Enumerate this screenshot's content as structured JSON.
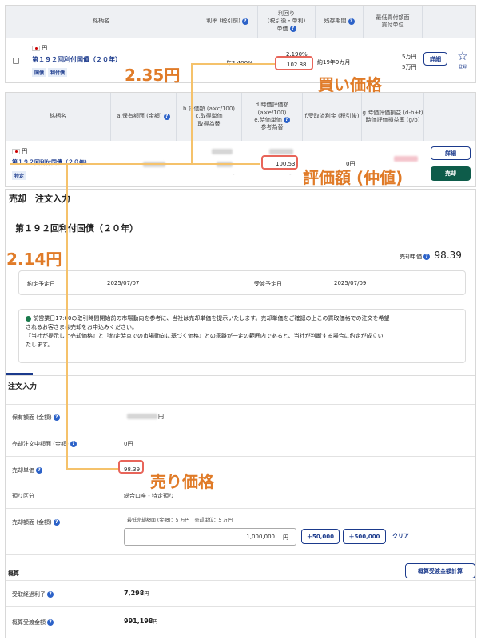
{
  "buy_list": {
    "headers": {
      "name": "銘柄名",
      "rate": "利率 (税引前)",
      "yield1": "利回り",
      "yield2": "(税引後・単利)",
      "price": "単価",
      "term": "残存期間",
      "min1": "最低買付額面",
      "min2": "買付単位"
    },
    "currency": "円",
    "bond_name": "第１９２回利付国債（２０年）",
    "tags": [
      "国債",
      "利付債"
    ],
    "rate": "年2.400%",
    "yield": "2.190%",
    "price": "102.88",
    "term": "約19年9カ月",
    "min_amount": "5万円",
    "unit": "5万円",
    "detail_btn": "詳細",
    "register_label": "登録"
  },
  "holdings": {
    "headers": {
      "name": "銘柄名",
      "face": "a.保有額面 (金額)",
      "eval1": "b.評価額 (a×c/100)",
      "eval2": "c.取得単価",
      "eval3": "取得為替",
      "mark1": "d.時価評価額 (a×e/100)",
      "mark2": "e.時価単価",
      "mark3": "参考為替",
      "recv": "f.受取済利金 (税引後)",
      "pl1": "g.時価評価損益 (d-b+f)",
      "pl2": "時価評価損益率 (g/b)"
    },
    "currency": "円",
    "bond_name": "第１９２回利付国債（２０年）",
    "tag": "特定",
    "mark_price": "100.53",
    "received": "0円",
    "dash1": "-",
    "dash2": "-",
    "detail_btn": "詳細",
    "sell_btn": "売却"
  },
  "sell_order": {
    "header": "売却　注文入力",
    "bond_title": "第１９２回利付国債（２０年）",
    "sell_price_label": "売却単価",
    "sell_price": "98.39",
    "trade_date_label": "約定予定日",
    "trade_date": "2025/07/07",
    "settle_date_label": "受渡予定日",
    "settle_date": "2025/07/09",
    "notice_line1": "前営業日17:00の取引時間開始前の市場動向を参考に、当社は売却単価を提示いたします。売却単価をご確認の上この買取価格での注文を希望",
    "notice_line2": "されるお客さまは売却をお申込みください。",
    "notice_line3": "『当社が提示した売却価格』と『約定時点での市場動向に基づく価格』との乖離が一定の範囲内であると、当社が判断する場合に約定が成立い",
    "notice_line4": "たします。",
    "section_title": "注文入力",
    "rows": {
      "held_label": "保有額面 (金額)",
      "held_suffix": "円",
      "pending_label": "売却注文中額面 (金額)",
      "pending_value": "0円",
      "price_label": "売却単価",
      "price_value": "98.39",
      "custody_label": "預り区分",
      "custody_value": "総合口座・特定預り",
      "amount_label": "売却額面 (金額)",
      "amount_note": "最低売却額面 (金額)：5 万円　売却単位：5 万円",
      "amount_value": "1,000,000",
      "amount_unit": "円",
      "plus50": "＋50,000",
      "plus500": "＋500,000",
      "clear": "クリア"
    },
    "estimate": {
      "title": "概算",
      "calc_btn": "概算受渡金額計算",
      "interest_label": "受取経過利子",
      "interest_value": "7,298",
      "interest_unit": "円",
      "total_label": "概算受渡金額",
      "total_value": "991,198",
      "total_unit": "円"
    }
  },
  "annotations": {
    "buy_price_diff": "2.35円",
    "buy_price_label": "買い価格",
    "eval_label": "評価額 (仲値)",
    "sell_price_diff": "2.14円",
    "sell_price_label": "売り価格"
  },
  "colors": {
    "annotation": "#e07b28",
    "highlight_box": "#e8655a",
    "connector": "#f5c26b",
    "brand_navy": "#1b3a8c",
    "sell_green": "#0e5c4a"
  }
}
